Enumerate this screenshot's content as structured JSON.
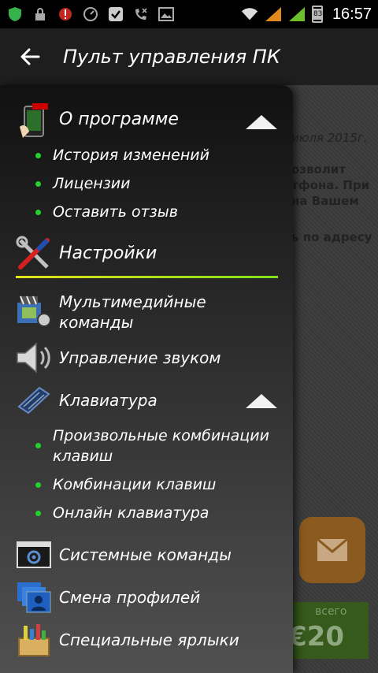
{
  "status_bar": {
    "time": "16:57",
    "battery_level": "83"
  },
  "app_bar": {
    "title": "Пульт управления ПК"
  },
  "background": {
    "date_text": "июля 2015г.",
    "line1": "озволит",
    "line2": "тфона. При",
    "line3": "на Вашем",
    "line4": "ь по адресу",
    "price_label": "всего",
    "price_value": "€20"
  },
  "drawer": {
    "about": {
      "label": "О программе",
      "items": [
        "История изменений",
        "Лицензии",
        "Оставить отзыв"
      ]
    },
    "settings": {
      "label": "Настройки"
    },
    "multimedia": {
      "label_line1": "Мультимедийные",
      "label_line2": "команды"
    },
    "sound": {
      "label": "Управление звуком"
    },
    "keyboard": {
      "label": "Клавиатура",
      "items": {
        "custom_line1": "Произвольные комбинации",
        "custom_line2": "клавиш",
        "combos": "Комбинации клавиш",
        "online": "Онлайн клавиатура"
      }
    },
    "system": {
      "label": "Системные команды"
    },
    "profiles": {
      "label": "Смена профилей"
    },
    "shortcuts": {
      "label": "Специальные ярлыки"
    }
  },
  "colors": {
    "accent_green": "#22d22a",
    "divider_start": "#e6e21a",
    "divider_end": "#7fe01a"
  }
}
